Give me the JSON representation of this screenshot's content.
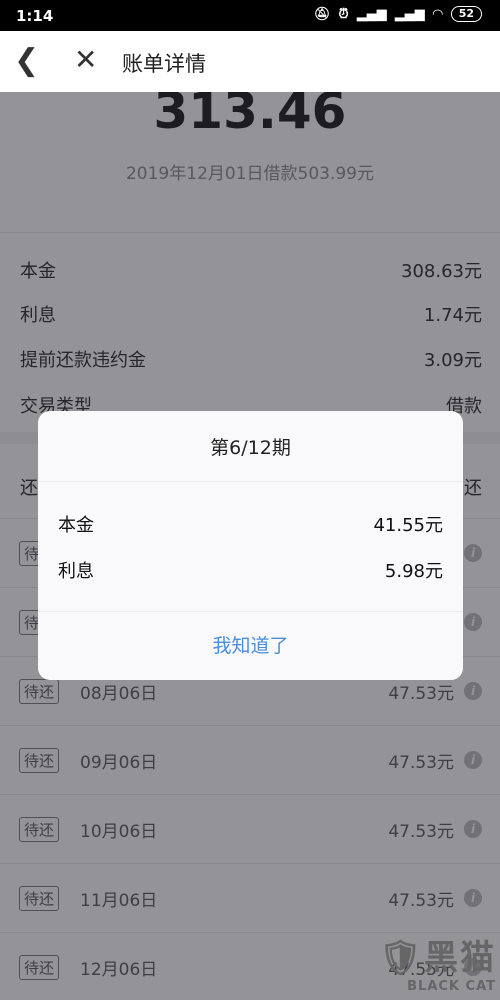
{
  "status": {
    "time": "1:14",
    "battery": "52",
    "icons": [
      "mute-icon",
      "alarm-icon",
      "signal-icon",
      "signal-icon",
      "wifi-icon"
    ]
  },
  "header": {
    "title": "账单详情"
  },
  "summary": {
    "amount": "313.46",
    "subtitle": "2019年12月01日借款503.99元"
  },
  "details": [
    {
      "label": "本金",
      "value": "308.63元"
    },
    {
      "label": "利息",
      "value": "1.74元"
    },
    {
      "label": "提前还款违约金",
      "value": "3.09元"
    },
    {
      "label": "交易类型",
      "value": "借款"
    }
  ],
  "schedule_header": {
    "left": "还",
    "right": "还"
  },
  "schedule": [
    {
      "tag": "待还",
      "date": "",
      "value": ""
    },
    {
      "tag": "待还",
      "date": "",
      "value": ""
    },
    {
      "tag": "待还",
      "date": "08月06日",
      "value": "47.53元"
    },
    {
      "tag": "待还",
      "date": "09月06日",
      "value": "47.53元"
    },
    {
      "tag": "待还",
      "date": "10月06日",
      "value": "47.53元"
    },
    {
      "tag": "待还",
      "date": "11月06日",
      "value": "47.53元"
    },
    {
      "tag": "待还",
      "date": "12月06日",
      "value": "47.55元"
    }
  ],
  "dialog": {
    "title": "第6/12期",
    "items": [
      {
        "label": "本金",
        "value": "41.55元"
      },
      {
        "label": "利息",
        "value": "5.98元"
      }
    ],
    "ok_label": "我知道了",
    "accent": "#4a8fd8"
  },
  "watermark": {
    "cn": "黑猫",
    "en": "BLACK CAT"
  }
}
